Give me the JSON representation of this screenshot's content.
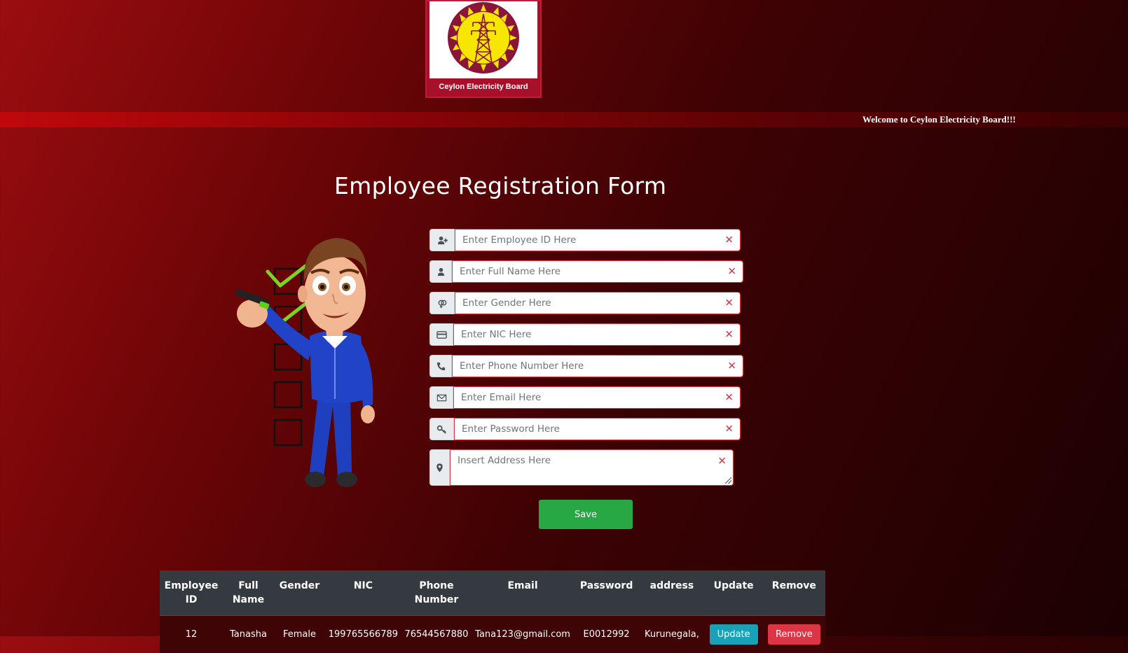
{
  "logo": {
    "text": "Ceylon Electricity Board"
  },
  "marquee": {
    "text": "Welcome to Ceylon Electricity Board!!!"
  },
  "page_title": "Employee Registration Form",
  "form": {
    "fields": [
      {
        "icon": "user-plus-icon",
        "placeholder": "Enter Employee ID Here",
        "value": ""
      },
      {
        "icon": "user-icon",
        "placeholder": "Enter Full Name Here",
        "value": ""
      },
      {
        "icon": "gender-icon",
        "placeholder": "Enter Gender Here",
        "value": ""
      },
      {
        "icon": "credit-card-icon",
        "placeholder": "Enter NIC Here",
        "value": ""
      },
      {
        "icon": "phone-icon",
        "placeholder": "Enter Phone Number Here",
        "value": ""
      },
      {
        "icon": "envelope-icon",
        "placeholder": "Enter Email Here",
        "value": ""
      },
      {
        "icon": "key-icon",
        "placeholder": "Enter Password Here",
        "value": ""
      },
      {
        "icon": "map-pin-icon",
        "placeholder": "Insert Address Here",
        "value": ""
      }
    ],
    "invalid_mark": "✕",
    "save_label": "Save"
  },
  "table": {
    "headers": [
      "Employee ID",
      "Full Name",
      "Gender",
      "NIC",
      "Phone Number",
      "Email",
      "Password",
      "address",
      "Update",
      "Remove"
    ],
    "rows": [
      {
        "id": "12",
        "name": "Tanasha",
        "gender": "Female",
        "nic": "199765566789",
        "phone": "76544567880",
        "email": "Tana123@gmail.com",
        "password": "E0012992",
        "address": "Kurunegala,",
        "update_label": "Update",
        "remove_label": "Remove"
      }
    ]
  },
  "colors": {
    "accent_green": "#28a745",
    "danger": "#dc3545",
    "info": "#17a2b8",
    "table_header": "#343a40"
  }
}
